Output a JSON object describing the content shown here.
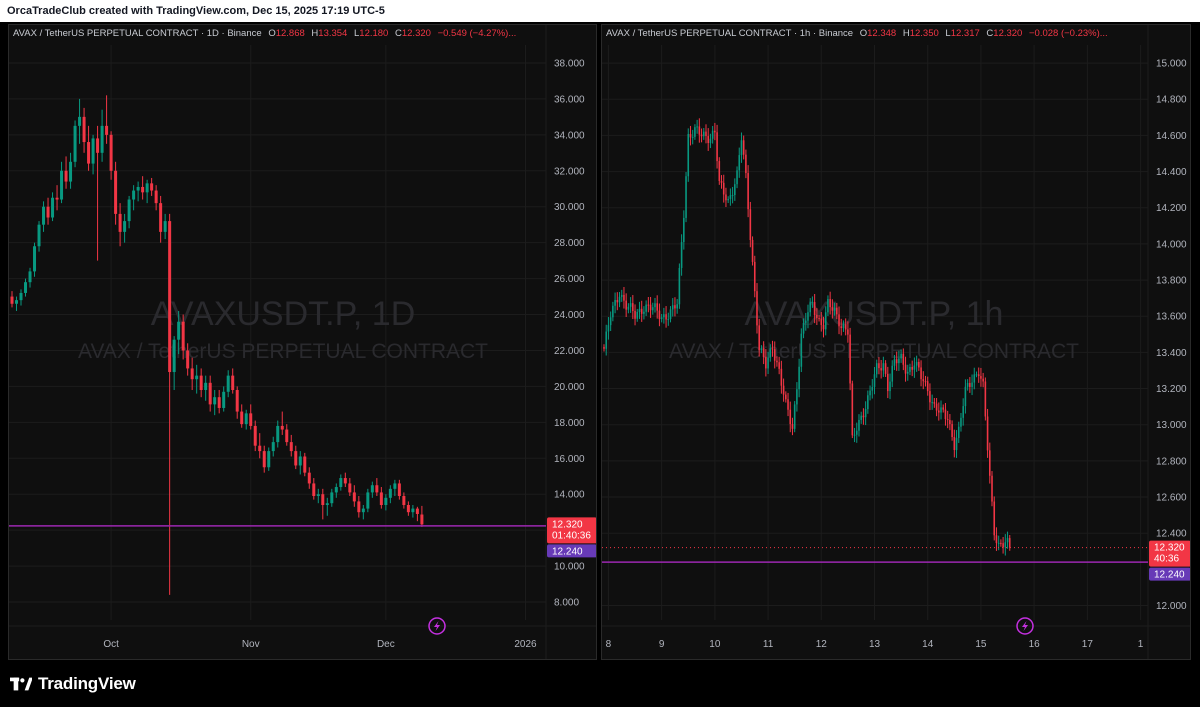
{
  "attribution": "OrcaTradeClub created with TradingView.com, Dec 15, 2025 17:19 UTC-5",
  "brand": "TradingView",
  "colors": {
    "up": "#089981",
    "down": "#f23645",
    "level_line": "#9c27b0",
    "level_label": "#673ab7",
    "background": "#0f0f0f",
    "grid": "#1c1c1c",
    "text": "#b2b5be",
    "watermark": "#2a2a2e"
  },
  "icons": [
    "lightning-icon",
    "tradingview-logo-icon"
  ],
  "panels": [
    {
      "symbol": "AVAX / TetherUS PERPETUAL CONTRACT · 1D · Binance",
      "ohlc": {
        "o_label": "O",
        "o": "12.868",
        "h_label": "H",
        "h": "13.354",
        "l_label": "L",
        "l": "12.180",
        "c_label": "C",
        "c": "12.320",
        "change": "−0.549 (−4.27%)",
        "more": "..."
      },
      "watermark_title": "AVAXUSDT.P, 1D",
      "watermark_subtitle": "AVAX / TetherUS PERPETUAL CONTRACT",
      "price_label": "12.320",
      "countdown": "01:40:36",
      "level_label": "12.240"
    },
    {
      "symbol": "AVAX / TetherUS PERPETUAL CONTRACT · 1h · Binance",
      "ohlc": {
        "o_label": "O",
        "o": "12.348",
        "h_label": "H",
        "h": "12.350",
        "l_label": "L",
        "l": "12.317",
        "c_label": "C",
        "c": "12.320",
        "change": "−0.028 (−0.23%)",
        "more": "..."
      },
      "watermark_title": "AVAXUSDT.P, 1h",
      "watermark_subtitle": "AVAX / TetherUS PERPETUAL CONTRACT",
      "price_label": "12.320",
      "countdown": "40:36",
      "level_label": "12.240"
    }
  ],
  "chart_data": [
    {
      "type": "candlestick",
      "title": "AVAXUSDT.P, 1D",
      "ylim": [
        7.0,
        39.0
      ],
      "y_ticks": [
        "38.000",
        "36.000",
        "34.000",
        "32.000",
        "30.000",
        "28.000",
        "26.000",
        "24.000",
        "22.000",
        "20.000",
        "18.000",
        "16.000",
        "14.000",
        "12.000",
        "10.000",
        "8.000"
      ],
      "x_ticks": [
        "Oct",
        "Nov",
        "Dec",
        "2026"
      ],
      "x_tick_index": [
        22,
        53,
        83,
        114
      ],
      "horizontal_line": 12.24,
      "last_price": 12.32,
      "grid": true,
      "candles": [
        [
          25.0,
          25.3,
          24.4,
          24.6
        ],
        [
          24.6,
          25.0,
          24.2,
          24.8
        ],
        [
          24.8,
          25.4,
          24.5,
          25.2
        ],
        [
          25.2,
          26.0,
          25.0,
          25.8
        ],
        [
          25.8,
          26.6,
          25.5,
          26.4
        ],
        [
          26.4,
          28.0,
          26.1,
          27.8
        ],
        [
          27.8,
          29.2,
          27.5,
          29.0
        ],
        [
          29.0,
          30.3,
          28.6,
          30.0
        ],
        [
          30.0,
          30.5,
          29.0,
          29.4
        ],
        [
          29.4,
          30.8,
          29.2,
          30.5
        ],
        [
          30.5,
          31.2,
          29.8,
          30.4
        ],
        [
          30.4,
          32.5,
          30.2,
          32.0
        ],
        [
          32.0,
          32.8,
          31.0,
          31.4
        ],
        [
          31.4,
          33.0,
          31.0,
          32.5
        ],
        [
          32.5,
          34.8,
          32.2,
          34.5
        ],
        [
          34.5,
          36.0,
          33.5,
          35.0
        ],
        [
          35.0,
          35.5,
          33.0,
          33.6
        ],
        [
          33.6,
          34.5,
          32.0,
          32.4
        ],
        [
          32.4,
          34.0,
          31.8,
          33.8
        ],
        [
          33.8,
          34.5,
          27.0,
          33.0
        ],
        [
          33.0,
          35.4,
          32.5,
          34.5
        ],
        [
          34.5,
          36.2,
          33.5,
          34.0
        ],
        [
          34.0,
          34.2,
          31.5,
          32.0
        ],
        [
          32.0,
          32.5,
          29.0,
          29.6
        ],
        [
          29.6,
          30.2,
          27.8,
          28.6
        ],
        [
          28.6,
          29.6,
          28.0,
          29.2
        ],
        [
          29.2,
          30.6,
          28.8,
          30.4
        ],
        [
          30.4,
          31.2,
          29.8,
          30.9
        ],
        [
          30.9,
          31.4,
          30.3,
          31.1
        ],
        [
          31.1,
          31.7,
          30.4,
          30.8
        ],
        [
          30.8,
          31.5,
          30.2,
          31.3
        ],
        [
          31.3,
          31.6,
          30.6,
          30.9
        ],
        [
          30.9,
          31.2,
          29.8,
          30.2
        ],
        [
          30.2,
          30.6,
          28.0,
          28.6
        ],
        [
          28.6,
          29.6,
          28.2,
          29.2
        ],
        [
          29.2,
          29.6,
          8.4,
          20.8
        ],
        [
          20.8,
          22.8,
          19.8,
          22.6
        ],
        [
          22.6,
          24.2,
          21.8,
          23.6
        ],
        [
          23.6,
          24.0,
          21.5,
          22.0
        ],
        [
          22.0,
          22.4,
          20.6,
          21.0
        ],
        [
          21.0,
          21.6,
          19.8,
          20.4
        ],
        [
          20.4,
          21.2,
          19.6,
          20.6
        ],
        [
          20.6,
          21.0,
          19.4,
          19.8
        ],
        [
          19.8,
          20.6,
          19.2,
          20.2
        ],
        [
          20.2,
          20.6,
          18.6,
          19.0
        ],
        [
          19.0,
          19.8,
          18.4,
          19.4
        ],
        [
          19.4,
          19.8,
          18.5,
          18.8
        ],
        [
          18.8,
          20.0,
          18.6,
          19.7
        ],
        [
          19.7,
          20.9,
          19.4,
          20.6
        ],
        [
          20.6,
          21.0,
          19.6,
          19.8
        ],
        [
          19.8,
          20.0,
          18.2,
          18.6
        ],
        [
          18.6,
          19.0,
          17.7,
          17.9
        ],
        [
          17.9,
          18.7,
          17.6,
          18.5
        ],
        [
          18.5,
          19.0,
          17.6,
          17.8
        ],
        [
          17.8,
          18.1,
          16.4,
          16.7
        ],
        [
          16.7,
          17.4,
          16.0,
          16.4
        ],
        [
          16.4,
          16.7,
          15.2,
          15.5
        ],
        [
          15.5,
          16.6,
          15.3,
          16.4
        ],
        [
          16.4,
          17.2,
          16.1,
          16.9
        ],
        [
          16.9,
          18.1,
          16.6,
          17.8
        ],
        [
          17.8,
          18.6,
          17.3,
          17.6
        ],
        [
          17.6,
          17.9,
          16.7,
          16.9
        ],
        [
          16.9,
          17.3,
          16.1,
          16.4
        ],
        [
          16.4,
          16.7,
          15.4,
          15.6
        ],
        [
          15.6,
          16.4,
          15.1,
          16.1
        ],
        [
          16.1,
          16.3,
          15.0,
          15.2
        ],
        [
          15.2,
          15.5,
          14.3,
          14.6
        ],
        [
          14.6,
          14.9,
          13.7,
          13.9
        ],
        [
          13.9,
          14.3,
          13.5,
          14.0
        ],
        [
          14.0,
          14.3,
          12.6,
          13.4
        ],
        [
          13.4,
          13.8,
          12.8,
          13.5
        ],
        [
          13.5,
          14.3,
          13.3,
          14.1
        ],
        [
          14.1,
          14.6,
          13.8,
          14.4
        ],
        [
          14.4,
          15.1,
          14.2,
          14.9
        ],
        [
          14.9,
          15.2,
          14.4,
          14.6
        ],
        [
          14.6,
          14.9,
          13.9,
          14.1
        ],
        [
          14.1,
          14.5,
          13.3,
          13.6
        ],
        [
          13.6,
          13.9,
          12.7,
          13.0
        ],
        [
          13.0,
          13.4,
          12.6,
          13.2
        ],
        [
          13.2,
          14.3,
          13.0,
          14.1
        ],
        [
          14.1,
          14.7,
          13.8,
          14.5
        ],
        [
          14.5,
          14.9,
          13.9,
          14.1
        ],
        [
          14.1,
          14.4,
          13.2,
          13.4
        ],
        [
          13.4,
          14.0,
          13.1,
          13.8
        ],
        [
          13.8,
          14.5,
          13.5,
          14.3
        ],
        [
          14.3,
          14.8,
          13.9,
          14.6
        ],
        [
          14.6,
          14.8,
          13.7,
          13.9
        ],
        [
          13.9,
          14.1,
          13.2,
          13.4
        ],
        [
          13.4,
          13.6,
          12.8,
          13.0
        ],
        [
          13.0,
          13.4,
          12.7,
          13.2
        ],
        [
          13.2,
          13.3,
          12.5,
          12.9
        ],
        [
          12.87,
          13.35,
          12.18,
          12.32
        ]
      ]
    },
    {
      "type": "candlestick",
      "title": "AVAXUSDT.P, 1h",
      "ylim": [
        11.92,
        15.1
      ],
      "y_ticks": [
        "15.000",
        "14.800",
        "14.600",
        "14.400",
        "14.200",
        "14.000",
        "13.800",
        "13.600",
        "13.400",
        "13.200",
        "13.000",
        "12.800",
        "12.600",
        "12.400",
        "12.000"
      ],
      "x_ticks": [
        "8",
        "9",
        "10",
        "11",
        "12",
        "13",
        "14",
        "15",
        "16",
        "17",
        "1"
      ],
      "x_tick_index": [
        2,
        26,
        50,
        74,
        98,
        122,
        146,
        170,
        194,
        218,
        242
      ],
      "horizontal_line": 12.24,
      "last_price": 12.32,
      "grid": true,
      "waypoints": [
        [
          0,
          13.42
        ],
        [
          3,
          13.6
        ],
        [
          7,
          13.74
        ],
        [
          10,
          13.66
        ],
        [
          14,
          13.6
        ],
        [
          18,
          13.66
        ],
        [
          22,
          13.64
        ],
        [
          26,
          13.6
        ],
        [
          30,
          13.62
        ],
        [
          33,
          13.66
        ],
        [
          36,
          14.18
        ],
        [
          38,
          14.6
        ],
        [
          41,
          14.62
        ],
        [
          44,
          14.6
        ],
        [
          48,
          14.6
        ],
        [
          50,
          14.62
        ],
        [
          52,
          14.32
        ],
        [
          56,
          14.24
        ],
        [
          60,
          14.38
        ],
        [
          62,
          14.58
        ],
        [
          64,
          14.36
        ],
        [
          67,
          13.9
        ],
        [
          70,
          13.42
        ],
        [
          73,
          13.32
        ],
        [
          76,
          13.44
        ],
        [
          79,
          13.3
        ],
        [
          82,
          13.1
        ],
        [
          85,
          12.98
        ],
        [
          87,
          13.22
        ],
        [
          89,
          13.5
        ],
        [
          92,
          13.62
        ],
        [
          94,
          13.66
        ],
        [
          97,
          13.58
        ],
        [
          99,
          13.56
        ],
        [
          101,
          13.66
        ],
        [
          104,
          13.62
        ],
        [
          107,
          13.56
        ],
        [
          110,
          13.52
        ],
        [
          112,
          12.9
        ],
        [
          114,
          12.98
        ],
        [
          117,
          13.08
        ],
        [
          120,
          13.18
        ],
        [
          123,
          13.3
        ],
        [
          126,
          13.34
        ],
        [
          128,
          13.22
        ],
        [
          131,
          13.34
        ],
        [
          134,
          13.36
        ],
        [
          137,
          13.3
        ],
        [
          140,
          13.34
        ],
        [
          143,
          13.26
        ],
        [
          146,
          13.2
        ],
        [
          149,
          13.1
        ],
        [
          152,
          13.06
        ],
        [
          155,
          13.04
        ],
        [
          158,
          12.9
        ],
        [
          160,
          12.96
        ],
        [
          163,
          13.18
        ],
        [
          166,
          13.26
        ],
        [
          169,
          13.3
        ],
        [
          171,
          13.2
        ],
        [
          174,
          12.7
        ],
        [
          176,
          12.42
        ],
        [
          178,
          12.34
        ],
        [
          181,
          12.34
        ],
        [
          183,
          12.32
        ]
      ]
    }
  ]
}
